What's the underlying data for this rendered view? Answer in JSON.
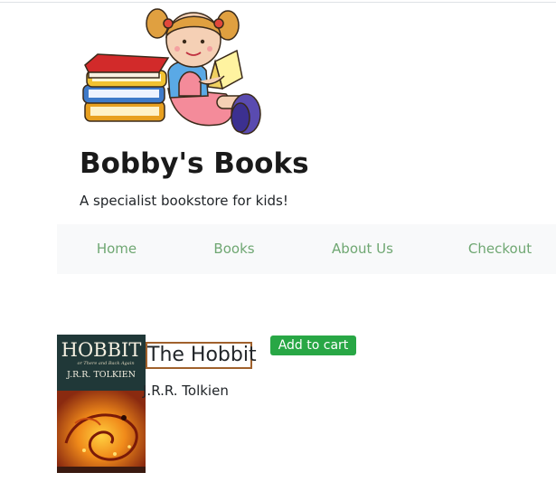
{
  "header": {
    "logo": "girl-reading-books-logo",
    "title": "Bobby's Books",
    "tagline": "A specialist bookstore for kids!"
  },
  "nav": {
    "items": [
      {
        "label": "Home"
      },
      {
        "label": "Books"
      },
      {
        "label": "About Us"
      },
      {
        "label": "Checkout"
      }
    ]
  },
  "product": {
    "title": "The Hobbit",
    "author": "J.R.R. Tolkien",
    "add_to_cart_label": "Add to cart",
    "cover": {
      "title_text": "HOBBIT",
      "subtitle_text": "or There and Back Again",
      "author_text": "J.R.R. TOLKIEN"
    }
  },
  "colors": {
    "nav_link": "#6fa772",
    "nav_bg": "#f8f9fa",
    "button_bg": "#28a745",
    "title_border": "#a0612c"
  }
}
